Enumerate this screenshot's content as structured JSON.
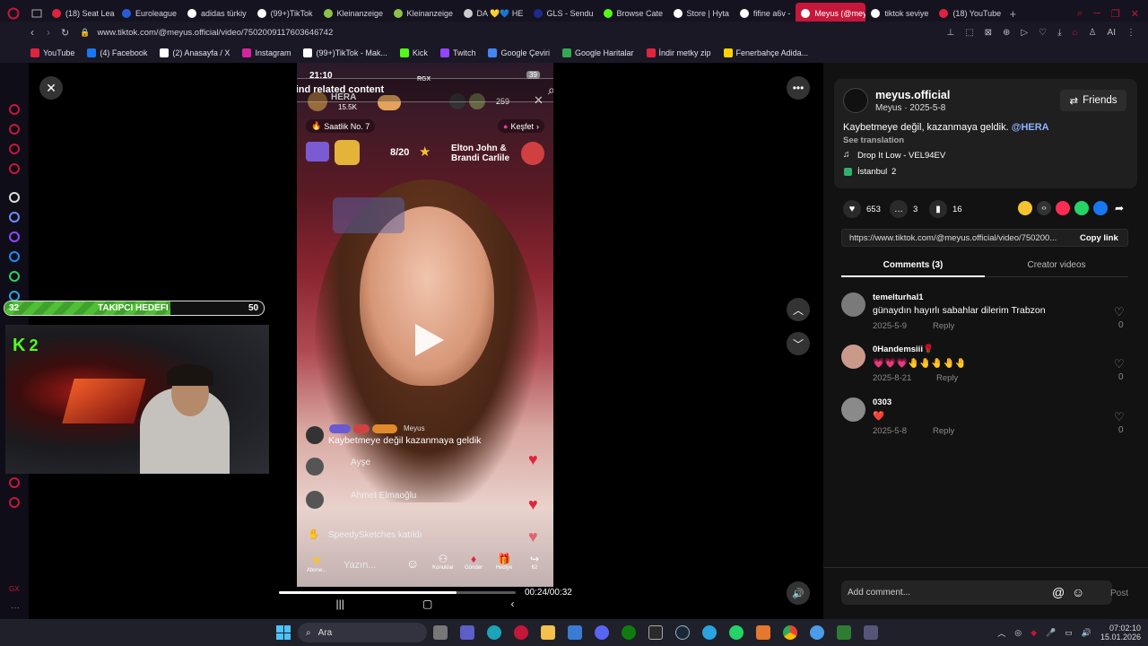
{
  "browser": {
    "tabs": [
      {
        "label": "(18) Seat Lea",
        "color": "#e0243d"
      },
      {
        "label": "Euroleague",
        "color": "#2a5bd7"
      },
      {
        "label": "adidas türkiy",
        "color": "#ffffff"
      },
      {
        "label": "(99+)TikTok",
        "color": "#ffffff"
      },
      {
        "label": "Kleinanzeige",
        "color": "#8bc34a"
      },
      {
        "label": "Kleinanzeige",
        "color": "#8bc34a"
      },
      {
        "label": "DA 💛💙 HE",
        "color": "#cccccc"
      },
      {
        "label": "GLS - Sendu",
        "color": "#1d2a8e"
      },
      {
        "label": "Browse Cate",
        "color": "#53fc18"
      },
      {
        "label": "Store | Hyta",
        "color": "#ffffff"
      },
      {
        "label": "fifine a6v - ",
        "color": "#ffffff"
      },
      {
        "label": "Meyus (@meyus.o",
        "color": "#ffffff",
        "active": true
      },
      {
        "label": "tiktok seviye",
        "color": "#ffffff"
      },
      {
        "label": "(18) YouTube",
        "color": "#e0243d"
      }
    ],
    "url": "www.tiktok.com/@meyus.official/video/7502009117603646742",
    "bookmarks": [
      {
        "label": "YouTube",
        "color": "#e0243d"
      },
      {
        "label": "(4) Facebook",
        "color": "#1877f2"
      },
      {
        "label": "(2) Anasayfa / X",
        "color": "#ffffff"
      },
      {
        "label": "Instagram",
        "color": "#d6249f"
      },
      {
        "label": "(99+)TikTok - Mak...",
        "color": "#ffffff"
      },
      {
        "label": "Kick",
        "color": "#53fc18"
      },
      {
        "label": "Twitch",
        "color": "#9146ff"
      },
      {
        "label": "Google Çeviri",
        "color": "#4285f4"
      },
      {
        "label": "Google Haritalar",
        "color": "#34a853"
      },
      {
        "label": "İndir metky zip",
        "color": "#e0243d"
      },
      {
        "label": "Fenerbahçe Adida...",
        "color": "#ffd200"
      }
    ]
  },
  "overlay": {
    "goal_label": "TAKIPCI HEDEFI",
    "goal_current": "32",
    "goal_target": "50",
    "kick_badge": "2"
  },
  "video": {
    "search_placeholder": "Find related content",
    "status_time": "21:10",
    "battery": "39",
    "host_name": "HERA",
    "host_likes": "15.5K",
    "viewers": "259",
    "rank_label": "Saatlik No. 7",
    "explore_label": "Keşfet",
    "progress_count": "8/20",
    "song_badge": "Elton John & Brandi Carlile",
    "gx_label": "RGX",
    "chat": [
      {
        "user": "Meyus",
        "text": "Kaybetmeye değil kazanmaya geldik"
      },
      {
        "user": "Ayşe",
        "text": ""
      },
      {
        "user": "Ahmet Elmaoğlu",
        "text": ""
      },
      {
        "user": "",
        "text": "SpeedySketches katıldı"
      }
    ],
    "input_placeholder": "Yazın...",
    "bottom_actions": [
      "Abone...",
      "Konuklar",
      "Gönder",
      "Hediye",
      "62"
    ],
    "time_current": "00:24",
    "time_total": "00:32",
    "time_display": "00:24/00:32",
    "progress": 0.75
  },
  "panel": {
    "author_handle": "meyus.official",
    "author_meta": "Meyus · 2025-5-8",
    "friends_label": "Friends",
    "caption": "Kaybetmeye değil, kazanmaya geldik.",
    "caption_mention": "@HERA",
    "see_translation": "See translation",
    "music": "Drop It Low - VEL94EV",
    "location": "İstanbul",
    "location_count": "2",
    "likes": "653",
    "comments_count": "3",
    "saves": "16",
    "link_url": "https://www.tiktok.com/@meyus.official/video/750200...",
    "copy_link_label": "Copy link",
    "tab_comments": "Comments (3)",
    "tab_creator": "Creator videos",
    "comments": [
      {
        "user": "temelturhal1",
        "text": "günaydın hayırlı sabahlar dilerim Trabzon",
        "date": "2025-5-9",
        "reply": "Reply",
        "likes": "0"
      },
      {
        "user": "0Handemsiii🌹",
        "text": "💗💗💗🤚🤚🤚🤚🤚",
        "date": "2025-8-21",
        "reply": "Reply",
        "likes": "0"
      },
      {
        "user": "0303",
        "text": "❤️",
        "date": "2025-5-8",
        "reply": "Reply",
        "likes": "0"
      }
    ],
    "add_comment_placeholder": "Add comment...",
    "post_label": "Post"
  },
  "taskbar": {
    "search_label": "Ara",
    "clock_time": "07:02:10",
    "clock_date": "15.01.2026"
  }
}
